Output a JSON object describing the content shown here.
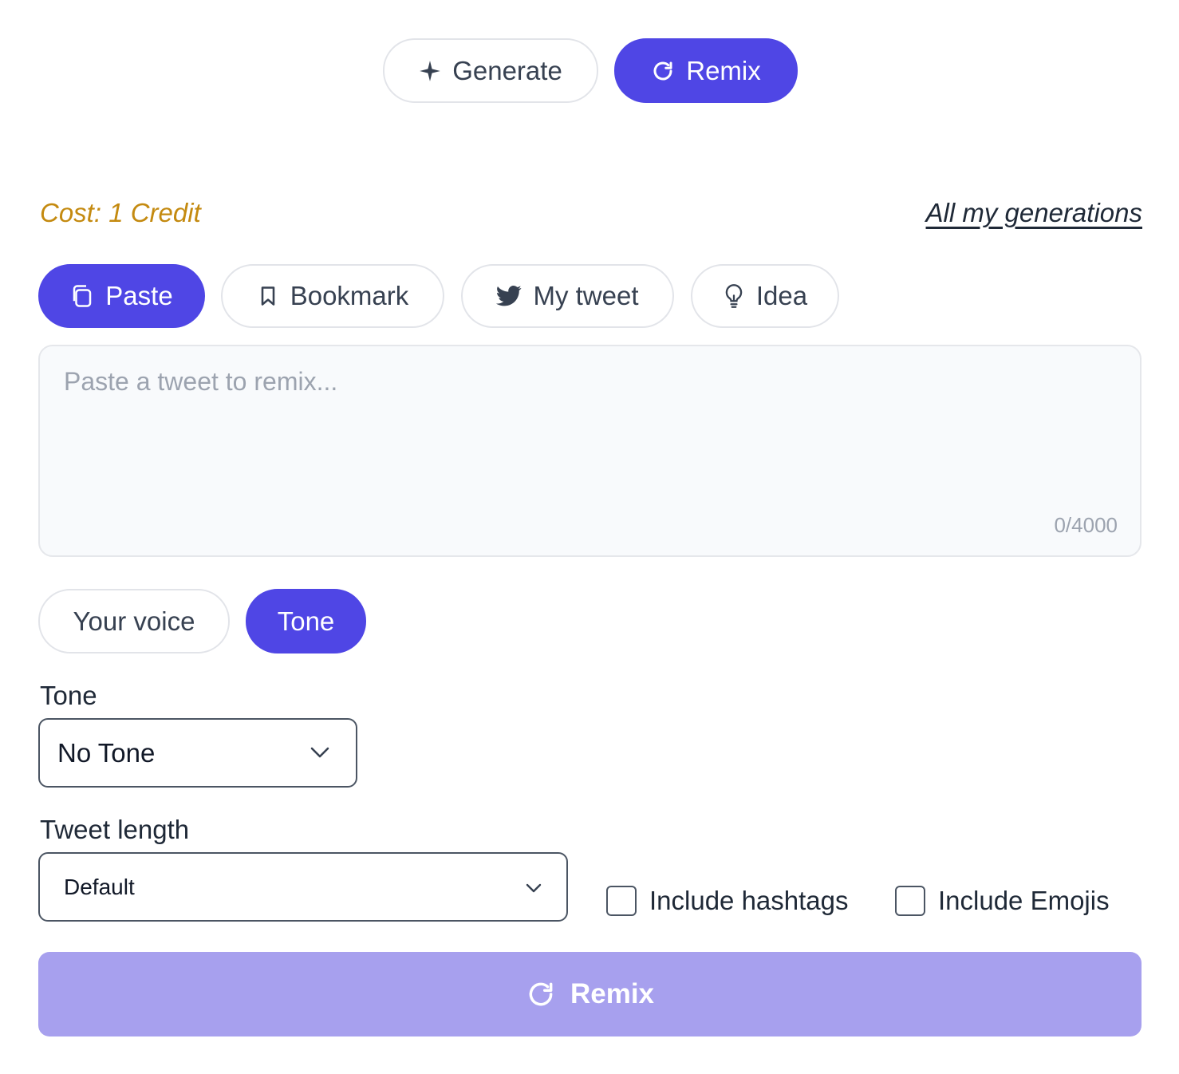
{
  "mode_tabs": [
    {
      "label": "Generate",
      "icon": "sparkle-icon",
      "active": false
    },
    {
      "label": "Remix",
      "icon": "refresh-icon",
      "active": true
    }
  ],
  "cost_text": "Cost: 1 Credit",
  "all_generations_link": "All my generations",
  "source_tabs": [
    {
      "label": "Paste",
      "icon": "copy-icon",
      "active": true
    },
    {
      "label": "Bookmark",
      "icon": "bookmark-icon",
      "active": false
    },
    {
      "label": "My tweet",
      "icon": "twitter-bird-icon",
      "active": false
    },
    {
      "label": "Idea",
      "icon": "lightbulb-icon",
      "active": false
    }
  ],
  "tweet_input": {
    "placeholder": "Paste a tweet to remix...",
    "char_count": "0/4000"
  },
  "style_tabs": [
    {
      "label": "Your voice",
      "active": false
    },
    {
      "label": "Tone",
      "active": true
    }
  ],
  "tone": {
    "label": "Tone",
    "value": "No Tone"
  },
  "tweet_length": {
    "label": "Tweet length",
    "value": "Default"
  },
  "options": {
    "hashtags_label": "Include hashtags",
    "emojis_label": "Include Emojis",
    "hashtags_checked": false,
    "emojis_checked": false
  },
  "submit_label": "Remix",
  "colors": {
    "accent": "#4f46e5",
    "accent_disabled": "#a7a0ee",
    "cost": "#c48a10"
  }
}
